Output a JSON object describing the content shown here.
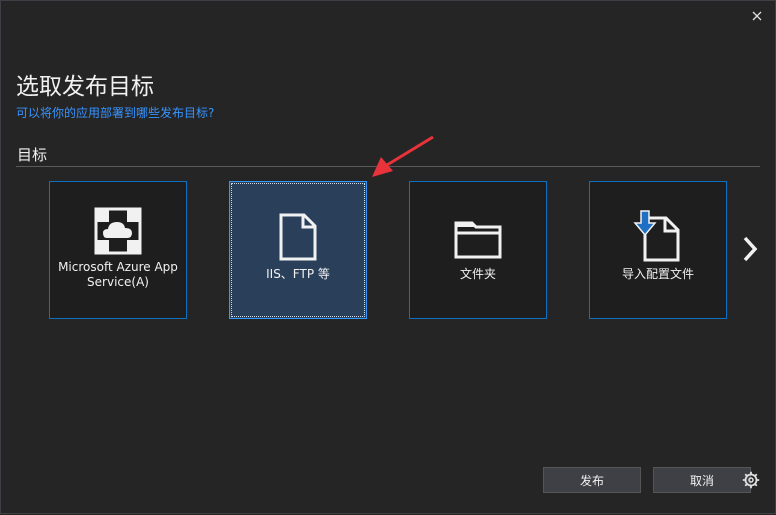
{
  "dialog": {
    "title": "选取发布目标",
    "subtitle": "可以将你的应用部署到哪些发布目标?",
    "section_label": "目标",
    "tiles": [
      {
        "label_line1": "Microsoft Azure App",
        "label_line2": "Service(A)",
        "icon": "azure-app-service-icon"
      },
      {
        "label": "IIS、FTP 等",
        "icon": "document-icon"
      },
      {
        "label": "文件夹",
        "icon": "folder-icon"
      },
      {
        "label": "导入配置文件",
        "icon": "import-profile-icon"
      }
    ],
    "buttons": {
      "publish": "发布",
      "cancel": "取消"
    }
  },
  "colors": {
    "background": "#252526",
    "tile_border": "#0e70c0",
    "tile_selected_bg": "#293f5a",
    "accent_text": "#3794ff",
    "annotation_arrow": "#e8333a"
  },
  "icons": {
    "close": "close-icon",
    "next": "chevron-right-icon",
    "settings": "gear-icon"
  }
}
